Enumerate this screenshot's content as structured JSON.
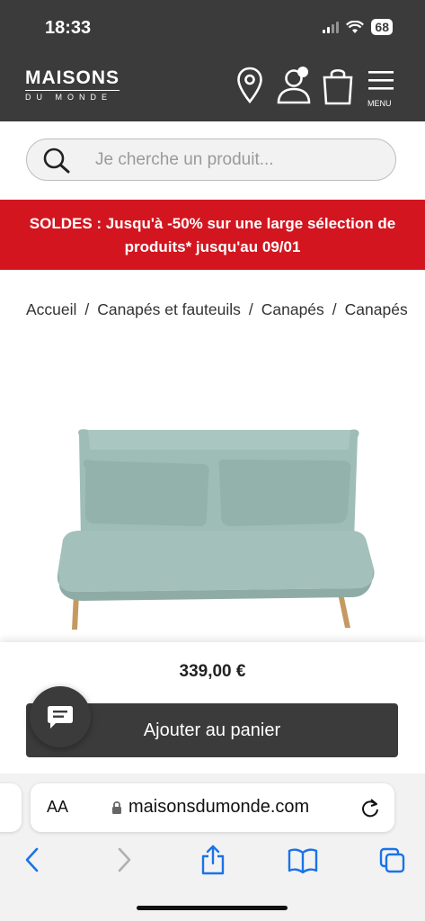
{
  "status_bar": {
    "time": "18:33",
    "battery": "68"
  },
  "header": {
    "logo_main": "MAISONS",
    "logo_sub": "DU MONDE",
    "menu_label": "MENU"
  },
  "search": {
    "placeholder": "Je cherche un produit..."
  },
  "promo": {
    "text": "SOLDES : Jusqu'à -50% sur une large sélection de produits* jusqu'au 09/01"
  },
  "breadcrumb": {
    "separator": "/",
    "items": [
      "Accueil",
      "Canapés et fauteuils",
      "Canapés",
      "Canapés"
    ]
  },
  "product": {
    "image_alt_icon": "sofa-bed-image",
    "price": "339,00 €",
    "add_to_cart_label": "Ajouter au panier"
  },
  "browser": {
    "aa_label": "AA",
    "url": "maisonsdumonde.com"
  },
  "colors": {
    "header_bg": "#3b3b3b",
    "promo_bg": "#d3151f",
    "safari_blue": "#1a73e8"
  }
}
